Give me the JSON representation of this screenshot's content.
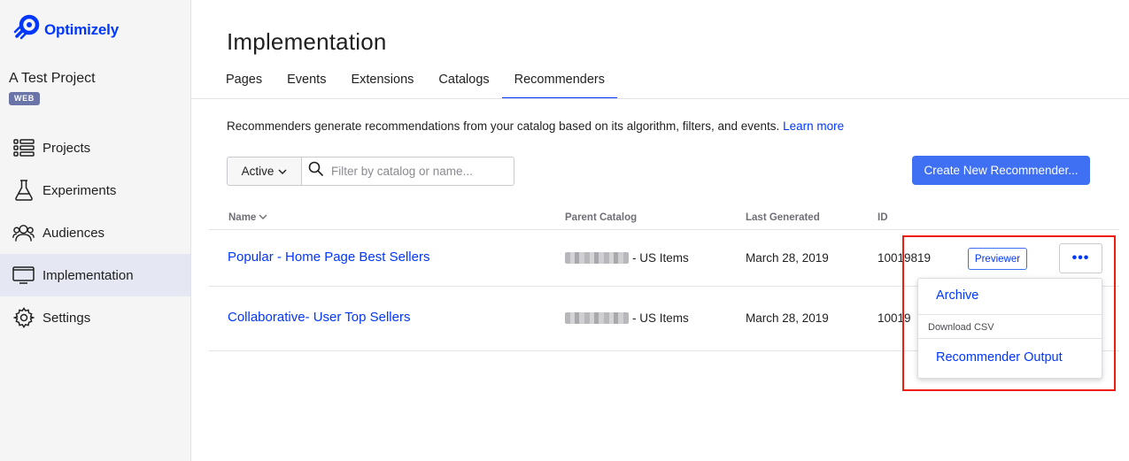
{
  "brand": {
    "name": "Optimizely",
    "color": "#0037ff",
    "icon": "optimizely-logo-icon"
  },
  "project": {
    "name": "A Test Project",
    "platform_badge": "WEB"
  },
  "sidebar": {
    "items": [
      {
        "label": "Projects",
        "icon": "list-icon",
        "active": false
      },
      {
        "label": "Experiments",
        "icon": "flask-icon",
        "active": false
      },
      {
        "label": "Audiences",
        "icon": "people-icon",
        "active": false
      },
      {
        "label": "Implementation",
        "icon": "monitor-icon",
        "active": true
      },
      {
        "label": "Settings",
        "icon": "gear-icon",
        "active": false
      }
    ]
  },
  "page": {
    "title": "Implementation",
    "tabs": [
      {
        "label": "Pages"
      },
      {
        "label": "Events"
      },
      {
        "label": "Extensions"
      },
      {
        "label": "Catalogs"
      },
      {
        "label": "Recommenders",
        "active": true
      }
    ],
    "intro": "Recommenders generate recommendations from your catalog based on its algorithm, filters, and events.",
    "learn_more": "Learn more"
  },
  "filters": {
    "status": "Active",
    "search_placeholder": "Filter by catalog or name...",
    "search_value": ""
  },
  "create_button": "Create New Recommender...",
  "table": {
    "columns": [
      "Name",
      "Parent Catalog",
      "Last Generated",
      "ID"
    ],
    "rows": [
      {
        "name": "Popular - Home Page Best Sellers",
        "catalog_suffix": "- US Items",
        "last_generated": "March 28, 2019",
        "id": "10019819"
      },
      {
        "name": "Collaborative- User Top Sellers",
        "catalog_suffix": "- US Items",
        "last_generated": "March 28, 2019",
        "id": "10019"
      }
    ],
    "previewer_label": "Previewer",
    "more_label": "•••"
  },
  "dropdown": {
    "archive": "Archive",
    "section_label": "Download CSV",
    "recommender_output": "Recommender Output"
  },
  "colors": {
    "accent": "#0037ff",
    "primary_button": "#3f6ff2",
    "highlight": "#ee1c12",
    "sidebar_bg": "#f5f5f6"
  }
}
